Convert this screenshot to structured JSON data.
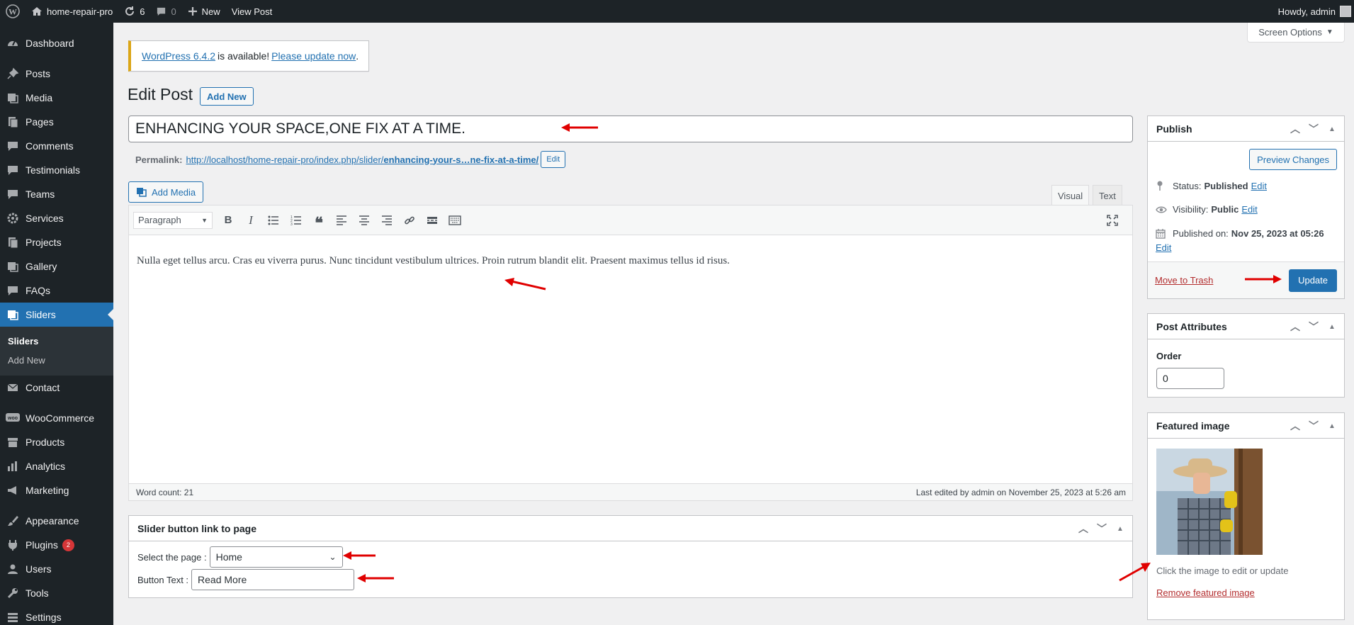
{
  "adminbar": {
    "site_name": "home-repair-pro",
    "updates_count": "6",
    "comments_count": "0",
    "new_label": "New",
    "view_post_label": "View Post",
    "greeting": "Howdy, admin"
  },
  "sidebar": {
    "items": [
      {
        "label": "Dashboard",
        "icon": "dashboard-icon"
      },
      {
        "label": "Posts",
        "icon": "pin-icon"
      },
      {
        "label": "Media",
        "icon": "media-icon"
      },
      {
        "label": "Pages",
        "icon": "pages-icon"
      },
      {
        "label": "Comments",
        "icon": "comment-icon"
      },
      {
        "label": "Testimonials",
        "icon": "comment-icon"
      },
      {
        "label": "Teams",
        "icon": "comment-icon"
      },
      {
        "label": "Services",
        "icon": "gear-icon"
      },
      {
        "label": "Projects",
        "icon": "pages-icon"
      },
      {
        "label": "Gallery",
        "icon": "media-icon"
      },
      {
        "label": "FAQs",
        "icon": "comment-icon"
      },
      {
        "label": "Sliders",
        "icon": "sliders-icon"
      },
      {
        "label": "Contact",
        "icon": "mail-icon"
      },
      {
        "label": "WooCommerce",
        "icon": "woocommerce-icon"
      },
      {
        "label": "Products",
        "icon": "archive-icon"
      },
      {
        "label": "Analytics",
        "icon": "chart-icon"
      },
      {
        "label": "Marketing",
        "icon": "megaphone-icon"
      },
      {
        "label": "Appearance",
        "icon": "brush-icon"
      },
      {
        "label": "Plugins",
        "icon": "plugin-icon",
        "badge": "2"
      },
      {
        "label": "Users",
        "icon": "user-icon"
      },
      {
        "label": "Tools",
        "icon": "wrench-icon"
      },
      {
        "label": "Settings",
        "icon": "settings-icon"
      }
    ],
    "submenu": {
      "current": "Sliders",
      "add_new": "Add New"
    }
  },
  "screen_options_label": "Screen Options",
  "notice": {
    "version_link": "WordPress 6.4.2",
    "middle_text": "is available!",
    "update_link": "Please update now",
    "end_text": "."
  },
  "page": {
    "title": "Edit Post",
    "add_new_label": "Add New"
  },
  "post": {
    "title": "ENHANCING YOUR SPACE,ONE FIX AT A TIME.",
    "permalink_label": "Permalink:",
    "permalink_base": "http://localhost/home-repair-pro/index.php/slider/",
    "permalink_slug": "enhancing-your-s…ne-fix-at-a-time/",
    "permalink_edit": "Edit",
    "add_media_label": "Add Media",
    "tab_visual": "Visual",
    "tab_text": "Text",
    "format_value": "Paragraph",
    "content": "Nulla eget tellus arcu. Cras eu viverra purus. Nunc tincidunt vestibulum ultrices. Proin rutrum blandit elit. Praesent maximus tellus id risus.",
    "word_count": "Word count: 21",
    "last_edited": "Last edited by admin on November 25, 2023 at 5:26 am"
  },
  "slider_box": {
    "title": "Slider button link to page",
    "select_label": "Select the page :",
    "select_value": "Home",
    "button_text_label": "Button Text :",
    "button_text_value": "Read More"
  },
  "publish": {
    "title": "Publish",
    "preview_label": "Preview Changes",
    "status_label": "Status:",
    "status_value": "Published",
    "visibility_label": "Visibility:",
    "visibility_value": "Public",
    "published_on_label": "Published on:",
    "published_on_value": "Nov 25, 2023 at 05:26",
    "edit_label": "Edit",
    "trash_label": "Move to Trash",
    "update_label": "Update"
  },
  "attributes": {
    "title": "Post Attributes",
    "order_label": "Order",
    "order_value": "0"
  },
  "featured": {
    "title": "Featured image",
    "hint": "Click the image to edit or update",
    "remove_label": "Remove featured image"
  },
  "colors": {
    "admin_bar": "#1d2327",
    "accent": "#2271b1",
    "annotation_arrow": "#e00000",
    "notice_border": "#dba617"
  }
}
